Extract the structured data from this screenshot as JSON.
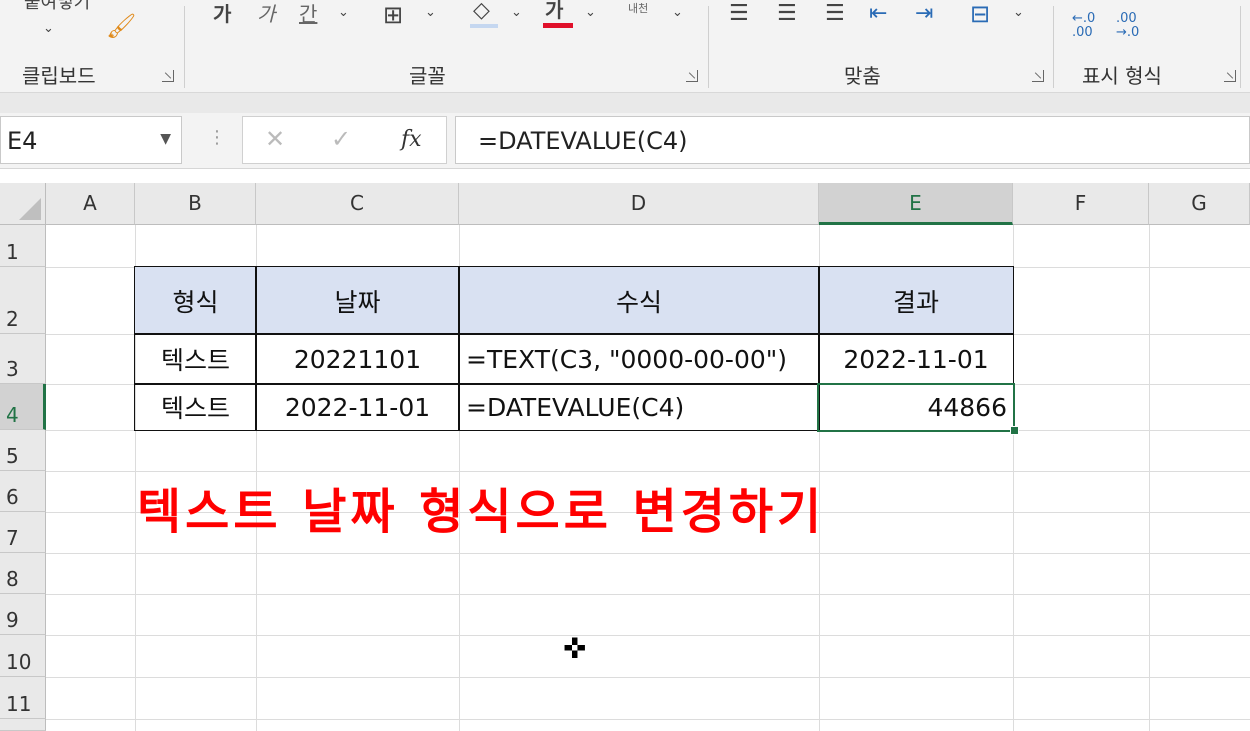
{
  "ribbon": {
    "clipboard": {
      "label": "클립보드",
      "paste_label": "붙여넣기"
    },
    "font": {
      "label": "글꼴",
      "bold": "가",
      "italic": "가",
      "underline": "간",
      "font_color_glyph": "가",
      "phonetic": "내천"
    },
    "alignment": {
      "label": "맞춤"
    },
    "number": {
      "label": "표시 형식",
      "increase_decimal": "←.0 .00",
      "decrease_decimal": ".00 →.0"
    }
  },
  "formula_bar": {
    "name_box": "E4",
    "cancel_icon": "✕",
    "enter_icon": "✓",
    "fx_label": "fx",
    "formula": "=DATEVALUE(C4)"
  },
  "columns": [
    "A",
    "B",
    "C",
    "D",
    "E",
    "F",
    "G"
  ],
  "rows": [
    "1",
    "2",
    "3",
    "4",
    "5",
    "6",
    "7",
    "8",
    "9",
    "10",
    "11"
  ],
  "table": {
    "headers": [
      "형식",
      "날짜",
      "수식",
      "결과"
    ],
    "row3": [
      "텍스트",
      "20221101",
      "=TEXT(C3, \"0000-00-00\")",
      "2022-11-01"
    ],
    "row4": [
      "텍스트",
      "2022-11-01",
      "=DATEVALUE(C4)",
      "44866"
    ]
  },
  "overlay_title": "텍스트 날짜 형식으로 변경하기",
  "colors": {
    "accent": "#217346",
    "header_fill": "#d9e1f2",
    "title": "#ff0000"
  }
}
